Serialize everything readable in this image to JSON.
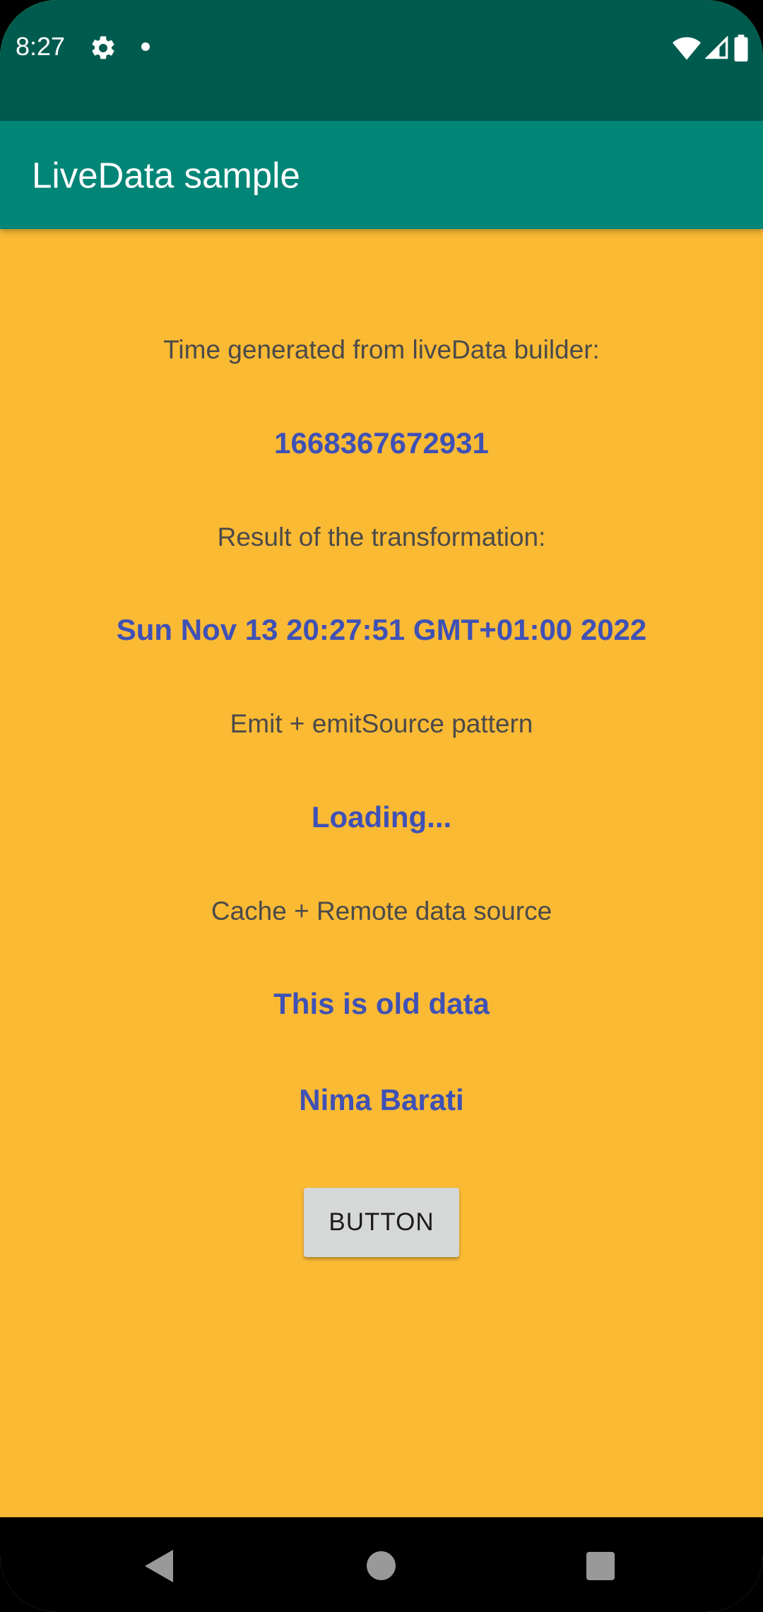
{
  "status_bar": {
    "time": "8:27",
    "icons": [
      "gear-icon",
      "notification-dot-icon",
      "wifi-icon",
      "cell-signal-icon",
      "battery-icon"
    ]
  },
  "app_bar": {
    "title": "LiveData sample"
  },
  "content": {
    "time_label": "Time generated from liveData builder:",
    "time_value": "1668367672931",
    "transform_label": "Result of the transformation:",
    "transform_value": "Sun Nov 13 20:27:51 GMT+01:00 2022",
    "emit_label": "Emit + emitSource pattern",
    "emit_value": "Loading...",
    "cache_label": "Cache + Remote data source",
    "cache_value": "This is old data",
    "name_value": "Nima Barati",
    "button_label": "BUTTON"
  },
  "nav_bar": {
    "icons": [
      "back-icon",
      "home-icon",
      "recents-icon"
    ]
  },
  "colors": {
    "status_bar": "#005B4F",
    "app_bar": "#008577",
    "background": "#FBBA34",
    "value_text": "#3F51B5",
    "button": "#D6D7D7"
  }
}
